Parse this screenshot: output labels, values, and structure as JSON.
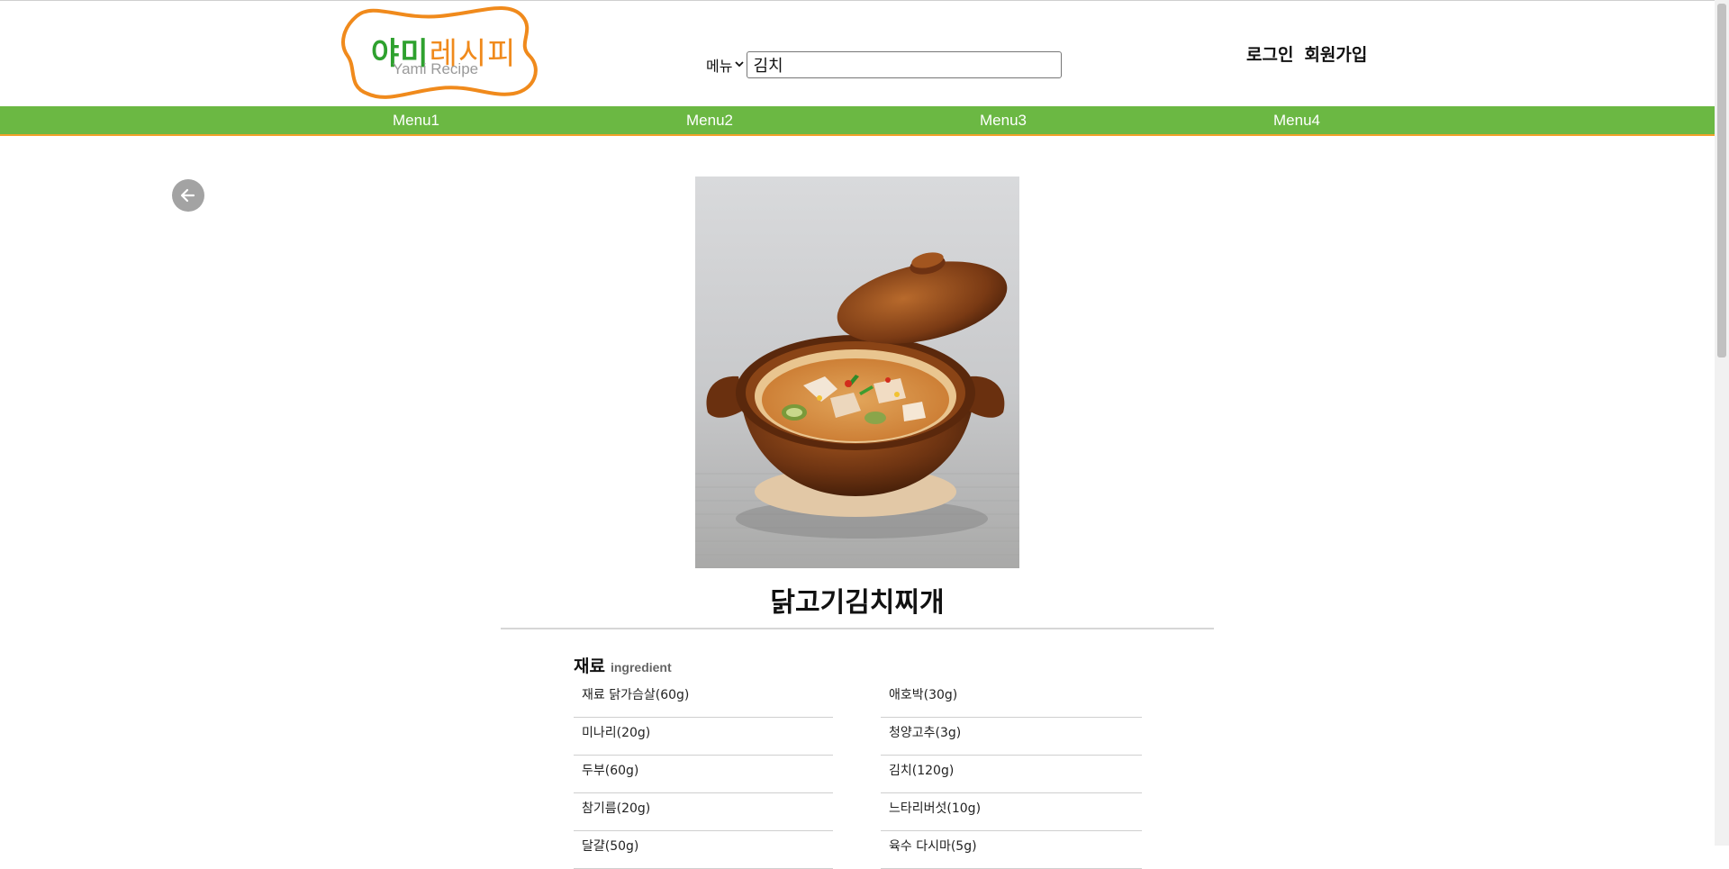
{
  "header": {
    "logo": {
      "text_ko_green": "야미",
      "text_ko_orange": "레시피",
      "text_en": "Yami Recipe"
    },
    "search": {
      "select_label": "메뉴",
      "select_icon": "chevron-down-icon",
      "query": "김치"
    },
    "auth": {
      "login": "로그인",
      "signup": "회원가입"
    }
  },
  "nav": {
    "items": [
      "Menu1",
      "Menu2",
      "Menu3",
      "Menu4"
    ]
  },
  "back_icon": "arrow-left-icon",
  "recipe": {
    "title": "닭고기김치찌개",
    "ingredient_heading_ko": "재료",
    "ingredient_heading_en": "ingredient",
    "ingredients_left": [
      "재료 닭가슴살(60g)",
      "미나리(20g)",
      "두부(60g)",
      "참기름(20g)",
      "달걀(50g)"
    ],
    "ingredients_right": [
      "애호박(30g)",
      "청양고추(3g)",
      "김치(120g)",
      "느타리버섯(10g)",
      "육수 다시마(5g)"
    ]
  },
  "colors": {
    "nav_bg": "#6bb843",
    "nav_border": "#f2a12a",
    "logo_orange": "#f08a1c",
    "logo_green": "#2ea12e"
  }
}
